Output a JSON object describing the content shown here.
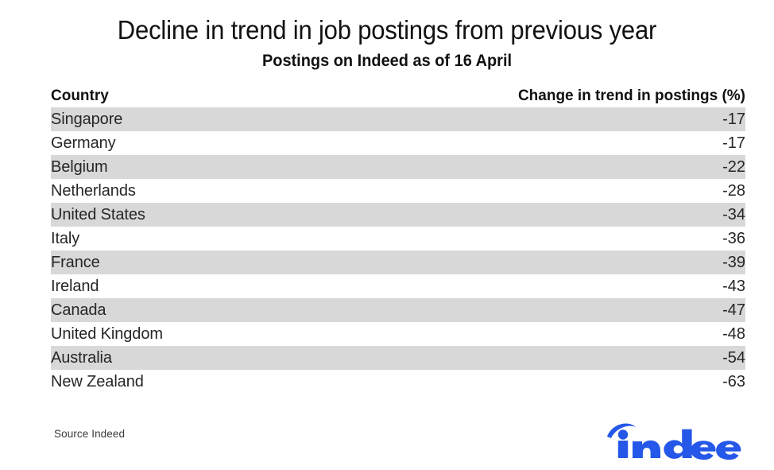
{
  "title": "Decline in trend in job postings from previous year",
  "subtitle": "Postings on Indeed as of 16 April",
  "table": {
    "headers": {
      "country": "Country",
      "value": "Change in trend in postings (%)"
    }
  },
  "footer": {
    "source": "Source Indeed",
    "logo_text": "indeed",
    "logo_name": "indeed-logo",
    "logo_color": "#2557e8"
  },
  "colors": {
    "band": "#d8d8d8",
    "text": "#262626",
    "title": "#111111",
    "background": "#ffffff",
    "brand_blue": "#2557e8"
  },
  "chart_data": {
    "type": "table",
    "title": "Decline in trend in job postings from previous year",
    "subtitle": "Postings on Indeed as of 16 April",
    "xlabel": "Country",
    "ylabel": "Change in trend in postings (%)",
    "columns": [
      "Country",
      "Change in trend in postings (%)"
    ],
    "categories": [
      "Singapore",
      "Germany",
      "Belgium",
      "Netherlands",
      "United States",
      "Italy",
      "France",
      "Ireland",
      "Canada",
      "United Kingdom",
      "Australia",
      "New Zealand"
    ],
    "values": [
      -17,
      -17,
      -22,
      -28,
      -34,
      -36,
      -39,
      -43,
      -47,
      -48,
      -54,
      -63
    ],
    "rows": [
      {
        "country": "Singapore",
        "value": "-17"
      },
      {
        "country": "Germany",
        "value": "-17"
      },
      {
        "country": "Belgium",
        "value": "-22"
      },
      {
        "country": "Netherlands",
        "value": "-28"
      },
      {
        "country": "United States",
        "value": "-34"
      },
      {
        "country": "Italy",
        "value": "-36"
      },
      {
        "country": "France",
        "value": "-39"
      },
      {
        "country": "Ireland",
        "value": "-43"
      },
      {
        "country": "Canada",
        "value": "-47"
      },
      {
        "country": "United Kingdom",
        "value": "-48"
      },
      {
        "country": "Australia",
        "value": "-54"
      },
      {
        "country": "New Zealand",
        "value": "-63"
      }
    ],
    "source": "Source Indeed",
    "units": "percent",
    "grid": false,
    "legend": "none"
  }
}
